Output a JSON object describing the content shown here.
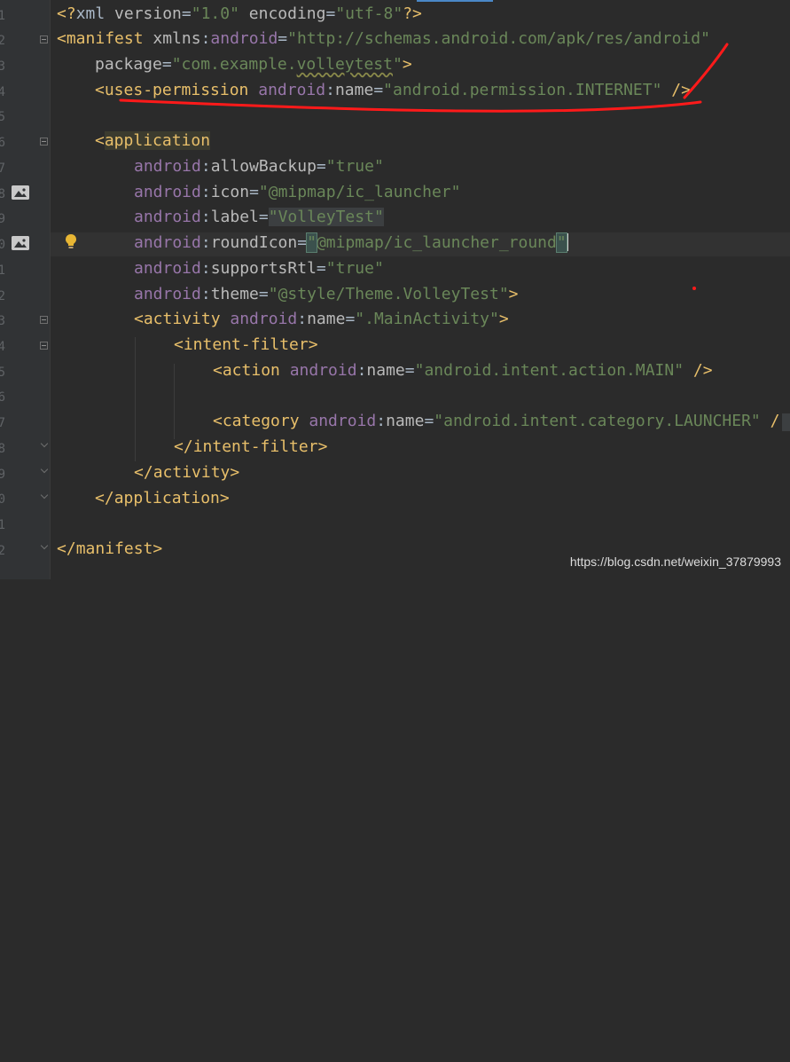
{
  "gutter": {
    "line_numbers": [
      "1",
      "2",
      "3",
      "4",
      "5",
      "6",
      "7",
      "8",
      "9",
      "0",
      "1",
      "2",
      "3",
      "4",
      "5",
      "6",
      "7",
      "8",
      "9",
      "0",
      "1",
      "2"
    ]
  },
  "code_lines": {
    "l1": {
      "open": "<?",
      "name": "xml",
      "a1": " version",
      "eq1": "=",
      "v1": "\"1.0\"",
      "a2": " encoding",
      "eq2": "=",
      "v2": "\"utf-8\"",
      "close": "?>"
    },
    "l2": {
      "open": "<",
      "name": "manifest",
      "a1": " xmlns",
      "colon": ":",
      "ns": "android",
      "eq": "=",
      "v": "\"http://schemas.android.com/apk/res/android\""
    },
    "l3": {
      "a": "package",
      "eq": "=",
      "v_pre": "\"com.example.",
      "v_sq": "volleytest",
      "v_post": "\"",
      "close": ">"
    },
    "l4": {
      "open": "<",
      "name": "uses-permission",
      "ns": " android",
      "colon": ":",
      "a": "name",
      "eq": "=",
      "v": "\"android.permission.INTERNET\"",
      "close": " />"
    },
    "l6": {
      "open": "<",
      "name": "application"
    },
    "l7": {
      "ns": "android",
      "colon": ":",
      "a": "allowBackup",
      "eq": "=",
      "v": "\"true\""
    },
    "l8": {
      "ns": "android",
      "colon": ":",
      "a": "icon",
      "eq": "=",
      "v": "\"@mipmap/ic_launcher\""
    },
    "l9": {
      "ns": "android",
      "colon": ":",
      "a": "label",
      "eq": "=",
      "v": "\"VolleyTest\""
    },
    "l10": {
      "ns": "android",
      "colon": ":",
      "a": "roundIcon",
      "eq": "=",
      "q1": "\"",
      "v": "@mipmap/ic_launcher_round",
      "q2": "\""
    },
    "l11": {
      "ns": "android",
      "colon": ":",
      "a": "supportsRtl",
      "eq": "=",
      "v": "\"true\""
    },
    "l12": {
      "ns": "android",
      "colon": ":",
      "a": "theme",
      "eq": "=",
      "v": "\"@style/Theme.VolleyTest\"",
      "close": ">"
    },
    "l13": {
      "open": "<",
      "name": "activity",
      "ns": " android",
      "colon": ":",
      "a": "name",
      "eq": "=",
      "v": "\".MainActivity\"",
      "close": ">"
    },
    "l14": {
      "open": "<",
      "name": "intent-filter",
      "close": ">"
    },
    "l15": {
      "open": "<",
      "name": "action",
      "ns": " android",
      "colon": ":",
      "a": "name",
      "eq": "=",
      "v": "\"android.intent.action.MAIN\"",
      "close": " />"
    },
    "l17": {
      "open": "<",
      "name": "category",
      "ns": " android",
      "colon": ":",
      "a": "name",
      "eq": "=",
      "v": "\"android.intent.category.LAUNCHER\"",
      "close": " /"
    },
    "l18": {
      "open": "</",
      "name": "intent-filter",
      "close": ">"
    },
    "l19": {
      "open": "</",
      "name": "activity",
      "close": ">"
    },
    "l20": {
      "open": "</",
      "name": "application",
      "close": ">"
    },
    "l22": {
      "open": "</",
      "name": "manifest",
      "close": ">"
    }
  },
  "watermark": "https://blog.csdn.net/weixin_37879993",
  "colors": {
    "background": "#2b2b2b",
    "gutter": "#313335",
    "tag": "#e8bf6a",
    "namespace": "#9876aa",
    "attribute": "#bababa",
    "value": "#6a8759",
    "annotation": "#ff1a1a"
  },
  "icons": [
    "image-icon",
    "lightbulb-icon",
    "fold-icon"
  ]
}
